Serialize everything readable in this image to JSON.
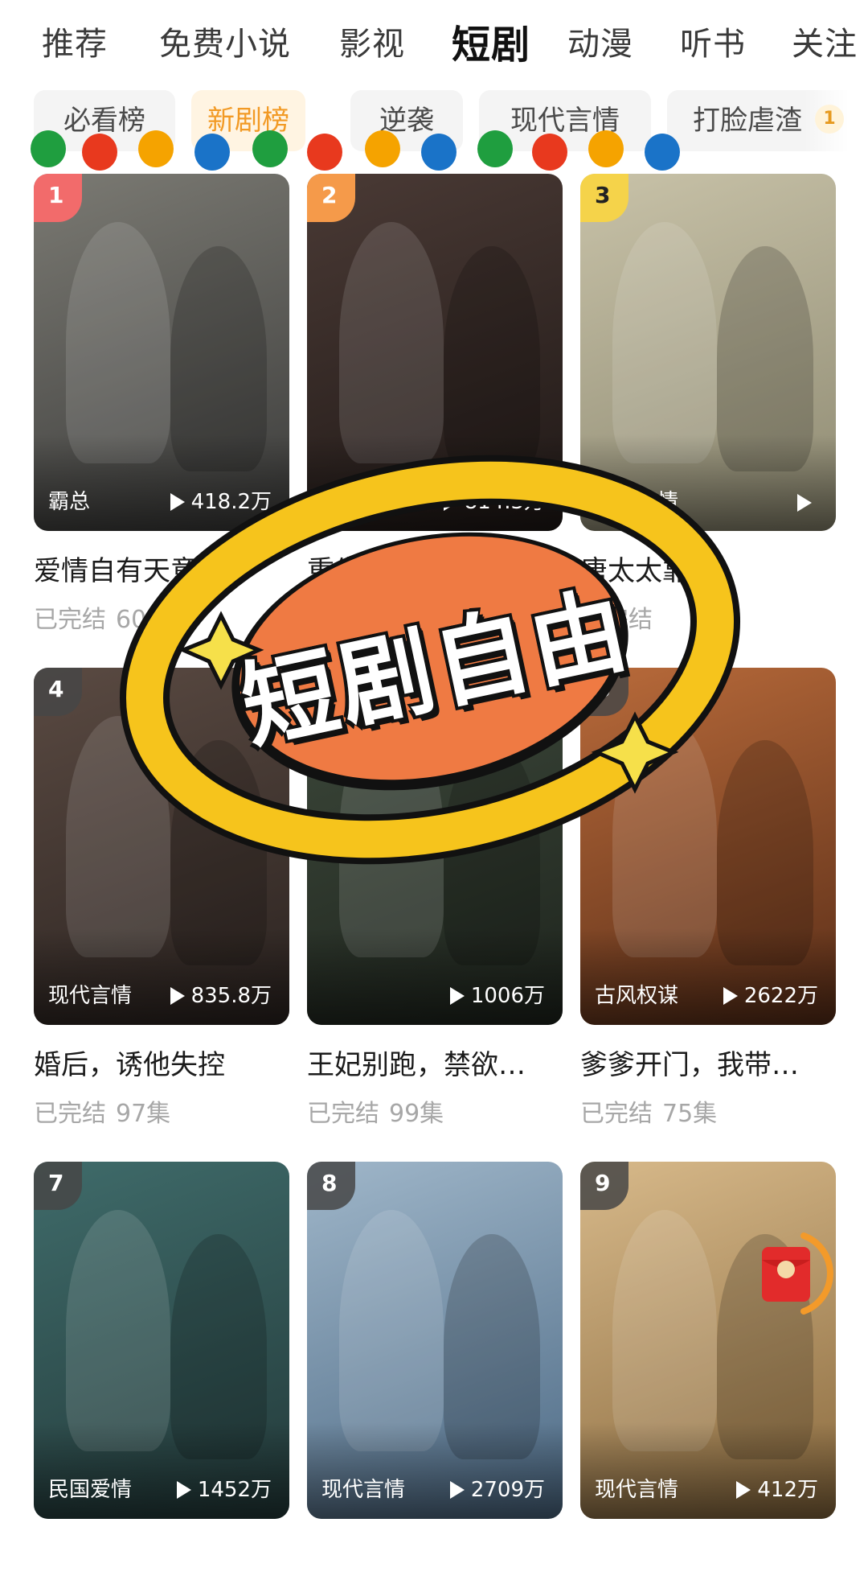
{
  "top_tabs": [
    {
      "label": "推荐"
    },
    {
      "label": "免费小说"
    },
    {
      "label": "影视"
    },
    {
      "label": "短剧",
      "active": true
    },
    {
      "label": "动漫"
    },
    {
      "label": "听书"
    },
    {
      "label": "关注"
    }
  ],
  "chips": [
    {
      "label": "必看榜"
    },
    {
      "label": "新剧榜",
      "active": true
    },
    {
      "label": "逆袭"
    },
    {
      "label": "现代言情"
    },
    {
      "label": "打脸虐渣"
    }
  ],
  "chip_badge": "1",
  "dots_colors": [
    "#1f9e3f",
    "#e8391e",
    "#f5a300",
    "#1a73c8"
  ],
  "sticker": {
    "text": "短剧自由",
    "ring_color": "#f6c41c",
    "fill_color": "#ef7a43"
  },
  "dramas": [
    {
      "rank": "1",
      "genre": "霸总",
      "plays": "418.2万",
      "title": "爱情自有天意",
      "status": "已完结",
      "episodes": "60集",
      "poster_colors": [
        "#7b7a73",
        "#3b3b3a"
      ]
    },
    {
      "rank": "2",
      "genre": "现代言情",
      "plays": "814.3万",
      "title": "重生后",
      "status": "已完结",
      "episodes": "77集",
      "poster_colors": [
        "#4a3a35",
        "#1f1816"
      ]
    },
    {
      "rank": "3",
      "genre": "现代言情",
      "plays": "",
      "title": "唐太太靠…",
      "status": "已完结",
      "episodes": "",
      "poster_colors": [
        "#c8c2a8",
        "#8e8a72"
      ]
    },
    {
      "rank": "4",
      "genre": "现代言情",
      "plays": "835.8万",
      "title": "婚后，诱他失控",
      "status": "已完结",
      "episodes": "97集",
      "poster_colors": [
        "#5a4a42",
        "#2b2320"
      ]
    },
    {
      "rank": "5",
      "genre": "",
      "plays": "1006万",
      "title": "王妃别跑，禁欲…",
      "status": "已完结",
      "episodes": "99集",
      "poster_colors": [
        "#3e4a3c",
        "#1e241d"
      ]
    },
    {
      "rank": "6",
      "genre": "古风权谋",
      "plays": "2622万",
      "title": "爹爹开门，我带…",
      "status": "已完结",
      "episodes": "75集",
      "poster_colors": [
        "#b86a3a",
        "#5a2e18"
      ]
    },
    {
      "rank": "7",
      "genre": "民国爱情",
      "plays": "1452万",
      "title": "",
      "status": "",
      "episodes": "",
      "poster_colors": [
        "#3f6b6a",
        "#233a3a"
      ]
    },
    {
      "rank": "8",
      "genre": "现代言情",
      "plays": "2709万",
      "title": "",
      "status": "",
      "episodes": "",
      "poster_colors": [
        "#9fb6c9",
        "#4d6a85"
      ]
    },
    {
      "rank": "9",
      "genre": "现代言情",
      "plays": "412万",
      "title": "",
      "status": "",
      "episodes": "",
      "poster_colors": [
        "#d7b98a",
        "#8a6a3e"
      ]
    }
  ]
}
